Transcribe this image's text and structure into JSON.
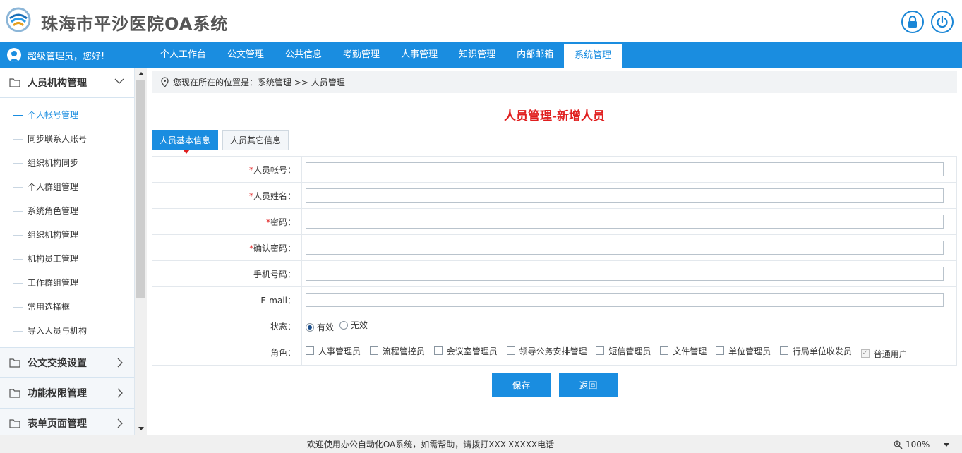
{
  "header": {
    "title": "珠海市平沙医院OA系统"
  },
  "navbar": {
    "greeting": "超级管理员，您好!",
    "tabs": [
      {
        "label": "个人工作台"
      },
      {
        "label": "公文管理"
      },
      {
        "label": "公共信息"
      },
      {
        "label": "考勤管理"
      },
      {
        "label": "人事管理"
      },
      {
        "label": "知识管理"
      },
      {
        "label": "内部邮箱"
      },
      {
        "label": "系统管理",
        "active": true
      }
    ]
  },
  "sidebar": {
    "section": "人员机构管理",
    "items": [
      {
        "label": "个人帐号管理",
        "active": true
      },
      {
        "label": "同步联系人账号"
      },
      {
        "label": "组织机构同步"
      },
      {
        "label": "个人群组管理"
      },
      {
        "label": "系统角色管理"
      },
      {
        "label": "组织机构管理"
      },
      {
        "label": "机构员工管理"
      },
      {
        "label": "工作群组管理"
      },
      {
        "label": "常用选择框"
      },
      {
        "label": "导入人员与机构"
      }
    ],
    "groups": [
      {
        "label": "公文交换设置"
      },
      {
        "label": "功能权限管理"
      },
      {
        "label": "表单页面管理"
      }
    ]
  },
  "main": {
    "breadcrumb": "您现在所在的位置是：系统管理 >> 人员管理",
    "title": "人员管理-新增人员",
    "tabs": [
      {
        "label": "人员基本信息",
        "active": true
      },
      {
        "label": "人员其它信息"
      }
    ],
    "fields": {
      "account": {
        "label": "人员帐号：",
        "value": ""
      },
      "name": {
        "label": "人员姓名：",
        "value": ""
      },
      "password": {
        "label": "密码：",
        "value": ""
      },
      "confirm": {
        "label": "确认密码：",
        "value": ""
      },
      "mobile": {
        "label": "手机号码：",
        "value": ""
      },
      "email": {
        "label": "E-mail：",
        "value": ""
      }
    },
    "status": {
      "label": "状态：",
      "options": [
        {
          "label": "有效",
          "checked": true
        },
        {
          "label": "无效",
          "checked": false
        }
      ]
    },
    "roles": {
      "label": "角色：",
      "options": [
        {
          "label": "人事管理员",
          "checked": false
        },
        {
          "label": "流程管控员",
          "checked": false
        },
        {
          "label": "会议室管理员",
          "checked": false
        },
        {
          "label": "领导公务安排管理",
          "checked": false
        },
        {
          "label": "短信管理员",
          "checked": false
        },
        {
          "label": "文件管理",
          "checked": false
        },
        {
          "label": "单位管理员",
          "checked": false
        },
        {
          "label": "行局单位收发员",
          "checked": false
        },
        {
          "label": "普通用户",
          "checked": true,
          "disabled": true
        }
      ]
    },
    "buttons": {
      "save": "保存",
      "back": "返回"
    }
  },
  "footer": {
    "text": "欢迎使用办公自动化OA系统，如需帮助，请拨打XXX-XXXXX电话",
    "zoom": "100%"
  },
  "colors": {
    "accent": "#1a8de0",
    "title_red": "#e01e1e"
  }
}
